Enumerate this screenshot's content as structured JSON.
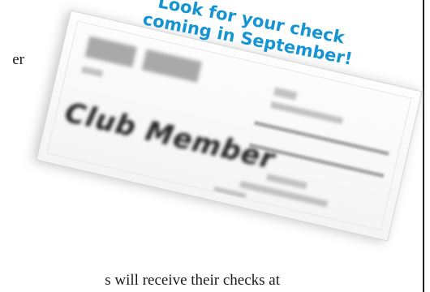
{
  "page": {
    "fragment_top": "er",
    "fragment_bottom": "s will receive their checks at"
  },
  "check": {
    "payee_blurred": "Club Member"
  },
  "callout": {
    "line1": "Look for your check",
    "line2": "coming in September!",
    "color": "#1594d3"
  }
}
